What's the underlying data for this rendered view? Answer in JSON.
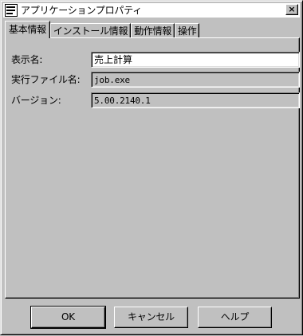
{
  "window": {
    "title": "アプリケーションプロパティ",
    "close_label": "×"
  },
  "tabs": [
    {
      "label": "基本情報",
      "active": true
    },
    {
      "label": "インストール情報",
      "active": false
    },
    {
      "label": "動作情報",
      "active": false
    },
    {
      "label": "操作",
      "active": false
    }
  ],
  "form": {
    "display_name_label": "表示名:",
    "display_name_value": "売上計算",
    "executable_label": "実行ファイル名:",
    "executable_value": "job.exe",
    "version_label": "バージョン:",
    "version_value": "5.00.2140.1"
  },
  "buttons": {
    "ok_label": "OK",
    "cancel_label": "キャンセル",
    "help_label": "ヘルプ"
  }
}
